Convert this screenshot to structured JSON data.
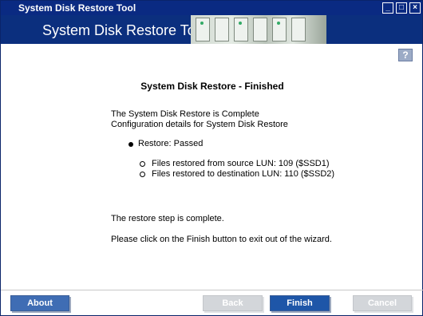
{
  "window": {
    "title": "System Disk Restore Tool"
  },
  "banner": {
    "title": "System Disk Restore Tool"
  },
  "help": {
    "label": "?"
  },
  "content": {
    "heading": "System Disk Restore - Finished",
    "line1": "The System Disk Restore is Complete",
    "line2": "Configuration details for System Disk Restore",
    "status": "Restore: Passed",
    "detail1": "Files restored from source LUN: 109 ($SSD1)",
    "detail2": "Files restored to destination LUN: 110 ($SSD2)",
    "complete": "The restore step is complete.",
    "instruction": "Please click on the Finish button to exit out of the wizard."
  },
  "buttons": {
    "about": "About",
    "back": "Back",
    "finish": "Finish",
    "cancel": "Cancel"
  }
}
